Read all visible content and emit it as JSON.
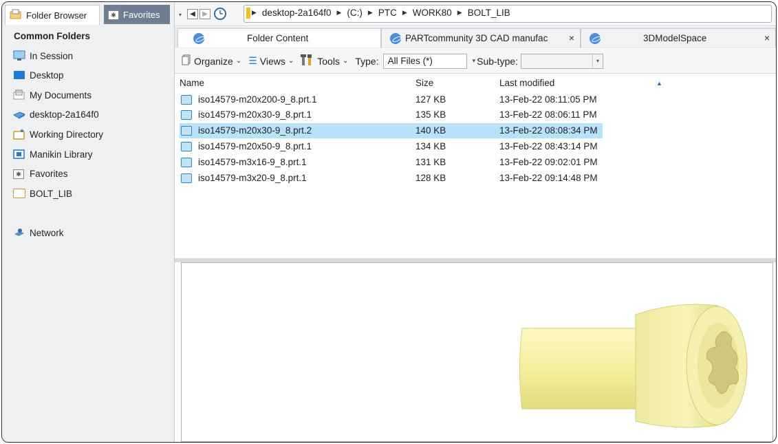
{
  "sidebar": {
    "tab_folder_browser": "Folder Browser",
    "tab_favorites": "Favorites",
    "heading": "Common Folders",
    "items": [
      {
        "label": "In Session",
        "icon": "monitor-icon"
      },
      {
        "label": "Desktop",
        "icon": "desktop-icon"
      },
      {
        "label": "My Documents",
        "icon": "documents-icon"
      },
      {
        "label": "desktop-2a164f0",
        "icon": "computer-icon"
      },
      {
        "label": "Working Directory",
        "icon": "working-directory-icon"
      },
      {
        "label": "Manikin Library",
        "icon": "manikin-library-icon"
      },
      {
        "label": "Favorites",
        "icon": "favorites-icon"
      },
      {
        "label": "BOLT_LIB",
        "icon": "folder-icon"
      },
      {
        "label": "Network",
        "icon": "network-icon"
      }
    ]
  },
  "address": {
    "crumbs": [
      "desktop-2a164f0",
      "(C:)",
      "PTC",
      "WORK80",
      "BOLT_LIB"
    ]
  },
  "tabs": [
    {
      "label": "Folder Content"
    },
    {
      "label": "PARTcommunity 3D CAD manufac"
    },
    {
      "label": "3DModelSpace"
    }
  ],
  "toolbar": {
    "organize": "Organize",
    "views": "Views",
    "tools": "Tools",
    "type_label": "Type:",
    "type_value": "All Files (*)",
    "subtype_label": "Sub-type:",
    "subtype_value": ""
  },
  "list": {
    "columns": {
      "name": "Name",
      "size": "Size",
      "modified": "Last modified"
    },
    "rows": [
      {
        "name": "iso14579-m20x200-9_8.prt.1",
        "size": "127 KB",
        "modified": "13-Feb-22 08:11:05 PM"
      },
      {
        "name": "iso14579-m20x30-9_8.prt.1",
        "size": "135 KB",
        "modified": "13-Feb-22 08:06:11 PM"
      },
      {
        "name": "iso14579-m20x30-9_8.prt.2",
        "size": "140 KB",
        "modified": "13-Feb-22 08:08:34 PM",
        "selected": true
      },
      {
        "name": "iso14579-m20x50-9_8.prt.1",
        "size": "134 KB",
        "modified": "13-Feb-22 08:43:14 PM"
      },
      {
        "name": "iso14579-m3x16-9_8.prt.1",
        "size": "131 KB",
        "modified": "13-Feb-22 09:02:01 PM"
      },
      {
        "name": "iso14579-m3x20-9_8.prt.1",
        "size": "128 KB",
        "modified": "13-Feb-22 09:14:48 PM"
      }
    ]
  },
  "colors": {
    "selection": "#b7e2f7",
    "part_yellow": "#f7f3a8",
    "inactive_tab": "#6f7f93"
  }
}
